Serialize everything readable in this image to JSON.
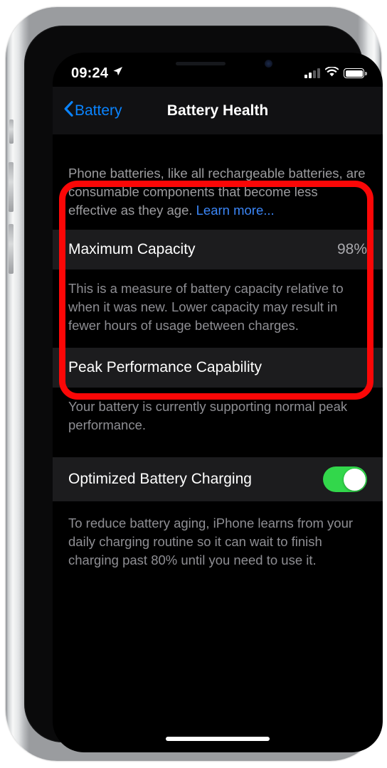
{
  "status_bar": {
    "time": "09:24",
    "location_icon": "location-arrow-icon",
    "signal_icon": "cellular-signal-icon",
    "signal_bars_filled": 2,
    "signal_bars_total": 4,
    "wifi_icon": "wifi-icon",
    "battery_icon": "battery-icon",
    "battery_level_percent": 100
  },
  "nav_bar": {
    "back_label": "Battery",
    "back_icon": "chevron-left-icon",
    "title": "Battery Health"
  },
  "header": {
    "text": "Phone batteries, like all rechargeable batteries, are consumable components that become less effective as they age. ",
    "link_label": "Learn more..."
  },
  "maximum_capacity": {
    "label": "Maximum Capacity",
    "value": "98%",
    "description": "This is a measure of battery capacity relative to when it was new. Lower capacity may result in fewer hours of usage between charges."
  },
  "peak_performance": {
    "label": "Peak Performance Capability",
    "description": "Your battery is currently supporting normal peak performance."
  },
  "optimized_charging": {
    "label": "Optimized Battery Charging",
    "toggle_state": "on",
    "description": "To reduce battery aging, iPhone learns from your daily charging routine so it can wait to finish charging past 80% until you need to use it."
  },
  "annotation": {
    "shape": "rounded-rectangle-highlight",
    "color": "#fb0707"
  },
  "colors": {
    "accent_blue": "#0a84ff",
    "link_blue": "#3b86f7",
    "toggle_green": "#32d74b",
    "cell_background": "#1c1c1e",
    "screen_background": "#000000",
    "secondary_text": "#8e8e93"
  }
}
